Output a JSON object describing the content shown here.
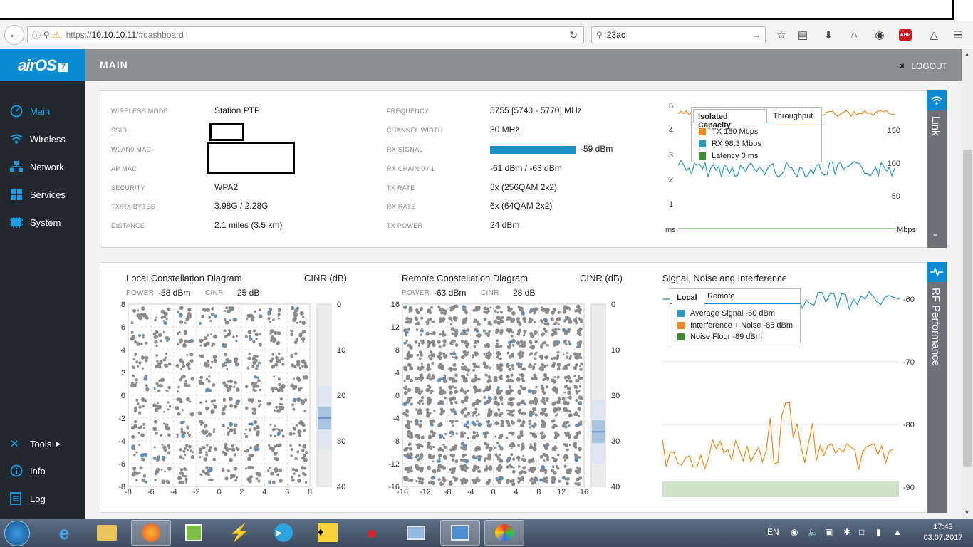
{
  "browser": {
    "url_prefix": "https://",
    "url_host": "10.10.10.11",
    "url_path": "/#dashboard",
    "search_value": "23ac",
    "abp_label": "ABP"
  },
  "app": {
    "logo_text": "airOS",
    "logo_version": "7",
    "page_title": "MAIN",
    "logout_label": "LOGOUT"
  },
  "sidebar": {
    "items": [
      {
        "label": "Main",
        "icon": "gauge-icon"
      },
      {
        "label": "Wireless",
        "icon": "wifi-icon"
      },
      {
        "label": "Network",
        "icon": "network-icon"
      },
      {
        "label": "Services",
        "icon": "services-icon"
      },
      {
        "label": "System",
        "icon": "system-icon"
      }
    ],
    "bottom": [
      {
        "label": "Tools",
        "icon": "tools-icon"
      },
      {
        "label": "Info",
        "icon": "info-icon"
      },
      {
        "label": "Log",
        "icon": "log-icon"
      }
    ]
  },
  "status": {
    "left": [
      {
        "label": "WIRELESS MODE",
        "value": "Station PTP"
      },
      {
        "label": "SSID",
        "value": ""
      },
      {
        "label": "WLAN0 MAC",
        "value": ""
      },
      {
        "label": "AP MAC",
        "value": ""
      },
      {
        "label": "SECURITY",
        "value": "WPA2"
      },
      {
        "label": "TX/RX BYTES",
        "value": "3.98G / 2.28G"
      },
      {
        "label": "DISTANCE",
        "value": "2.1 miles (3.5 km)"
      }
    ],
    "right": [
      {
        "label": "FREQUENCY",
        "value": "5755 [5740 - 5770] MHz"
      },
      {
        "label": "CHANNEL WIDTH",
        "value": "30 MHz"
      },
      {
        "label": "RX SIGNAL",
        "value": "-59 dBm",
        "bar_fraction": 1.0
      },
      {
        "label": "RX CHAIN 0 / 1",
        "value": "-61 dBm / -63 dBm"
      },
      {
        "label": "TX RATE",
        "value": "8x (256QAM 2x2)"
      },
      {
        "label": "RX RATE",
        "value": "6x (64QAM 2x2)"
      },
      {
        "label": "TX POWER",
        "value": "24 dBm"
      }
    ]
  },
  "link_chart": {
    "tabs": [
      "Isolated Capacity",
      "Throughput"
    ],
    "legend": [
      "TX 180 Mbps",
      "RX 98.3 Mbps",
      "Latency 0 ms"
    ],
    "left_ticks": [
      "5",
      "4",
      "3",
      "2",
      "1"
    ],
    "right_ticks": [
      "150",
      "100",
      "50"
    ],
    "left_unit": "ms",
    "right_unit": "Mbps",
    "side_tab": "Link",
    "colors": {
      "tx": "#f08a1c",
      "rx": "#2a97c9",
      "latency": "#3a8f2a"
    }
  },
  "local_const": {
    "title": "Local Constellation Diagram",
    "cinr_title": "CINR (dB)",
    "power_label": "POWER",
    "power_value": "-58 dBm",
    "cinr_label": "CINR",
    "cinr_value": "25 dB",
    "x_ticks": [
      "-8",
      "-6",
      "-4",
      "-2",
      "0",
      "2",
      "4",
      "6",
      "8"
    ],
    "y_ticks": [
      "8",
      "6",
      "4",
      "2",
      "0",
      "-2",
      "-4",
      "-6",
      "-8"
    ],
    "cinr_ticks": [
      "0",
      "10",
      "20",
      "30",
      "40"
    ],
    "cinr_level": 25
  },
  "remote_const": {
    "title": "Remote Constellation Diagram",
    "cinr_title": "CINR (dB)",
    "power_label": "POWER",
    "power_value": "-63 dBm",
    "cinr_label": "CINR",
    "cinr_value": "28 dB",
    "x_ticks": [
      "-16",
      "-12",
      "-8",
      "-4",
      "0",
      "4",
      "8",
      "12",
      "16"
    ],
    "y_ticks": [
      "16",
      "12",
      "8",
      "4",
      "0",
      "-4",
      "-8",
      "-12",
      "-16"
    ],
    "cinr_ticks": [
      "0",
      "10",
      "20",
      "30",
      "40"
    ],
    "cinr_level": 28
  },
  "rf_chart": {
    "title": "Signal, Noise and Interference",
    "tabs": [
      "Local",
      "Remote"
    ],
    "legend": [
      "Average Signal -60 dBm",
      "Interference + Noise -85 dBm",
      "Noise Floor -89 dBm"
    ],
    "right_ticks": [
      "-60",
      "-70",
      "-80",
      "-90"
    ],
    "side_tab": "RF Performance",
    "colors": {
      "signal": "#2a97c9",
      "interference": "#f08a1c",
      "noise": "#3a8f2a"
    }
  },
  "taskbar": {
    "lang": "EN",
    "time": "17:43",
    "date": "03.07.2017"
  }
}
